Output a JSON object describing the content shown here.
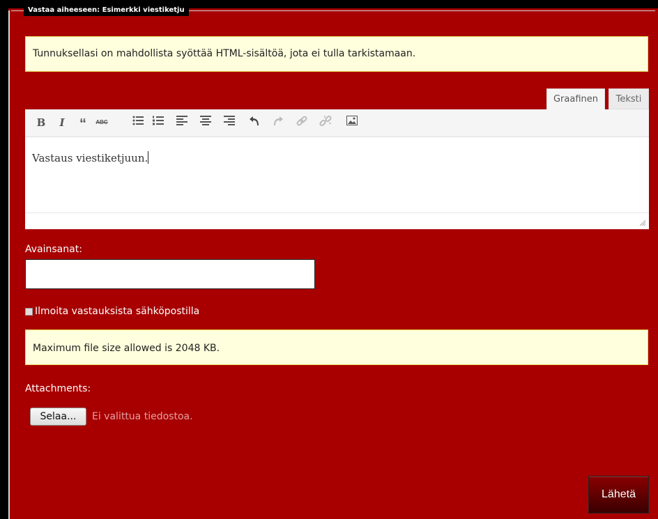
{
  "legend": "Vastaa aiheeseen: Esimerkki viestiketju",
  "notice_html": "Tunnuksellasi on mahdollista syöttää HTML-sisältöä, jota ei tulla tarkistamaan.",
  "editor": {
    "tabs": [
      {
        "label": "Graafinen",
        "active": true
      },
      {
        "label": "Teksti",
        "active": false
      }
    ],
    "toolbar": [
      "bold",
      "italic",
      "blockquote",
      "strikethrough",
      "bullet-list",
      "numbered-list",
      "align-left",
      "align-center",
      "align-right",
      "undo",
      "redo",
      "link",
      "unlink",
      "image"
    ],
    "content": "Vastaus viestiketjuun."
  },
  "tags": {
    "label": "Avainsanat:",
    "value": ""
  },
  "notify": {
    "label": "Ilmoita vastauksista sähköpostilla",
    "checked": false
  },
  "notice_filesize": "Maximum file size allowed is 2048 KB.",
  "attachments": {
    "label": "Attachments:",
    "browse_label": "Selaa...",
    "no_file_text": "Ei valittua tiedostoa."
  },
  "submit_label": "Lähetä",
  "colors": {
    "background": "#a80000",
    "notice": "#fffedd"
  }
}
